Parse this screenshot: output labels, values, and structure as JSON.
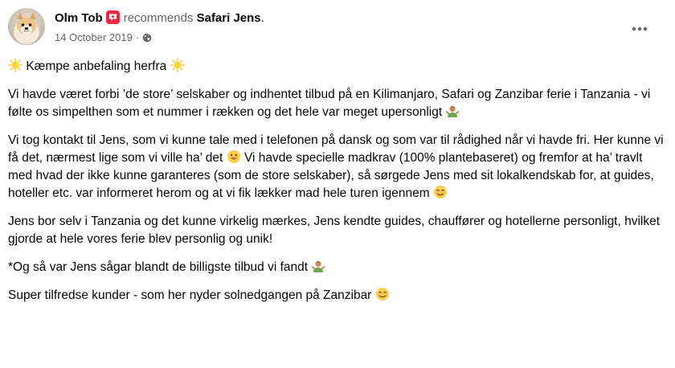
{
  "post": {
    "author_name": "Olm Tob",
    "action_text": "recommends",
    "page_name": "Safari Jens",
    "trailing_dot": ".",
    "date": "14 October 2019",
    "date_separator": "·",
    "more_icon": "more-horizontal-icon",
    "privacy_icon": "globe-icon",
    "badge_icon": "recommend-badge-icon",
    "colors": {
      "badge": "#f02849",
      "secondary_text": "#65676b",
      "primary_text": "#050505"
    }
  },
  "content": {
    "p1": "Kæmpe anbefaling herfra",
    "p2": "Vi havde været forbi ’de store’ selskaber og indhentet tilbud på en Kilimanjaro, Safari og Zanzibar ferie i Tanzania - vi følte os simpelthen som et nummer i rækken og det hele var meget upersonligt",
    "p3a": "Vi tog kontakt til Jens, som vi kunne tale med i telefonen på dansk og som var til rådighed når vi havde fri. Her kunne vi få det, nærmest lige som vi ville ha’ det",
    "p3b": "Vi havde specielle madkrav (100% plantebaseret) og fremfor at ha’ travlt med hvad der ikke kunne garanteres (som de store selskaber), så sørgede Jens med sit lokalkendskab for, at guides, hoteller etc. var informeret herom og at vi fik lækker mad hele turen igennem",
    "p4": "Jens bor selv i Tanzania og det kunne virkelig mærkes, Jens kendte guides, chauffører og hotellerne personligt, hvilket gjorde at hele vores ferie blev personlig og unik!",
    "p5": "*Og så var Jens sågar blandt de billigste tilbud vi fandt",
    "p6": "Super tilfredse kunder - som her nyder solnedgangen på Zanzibar",
    "emojis": [
      "sun-emoji",
      "person-shrugging-emoji",
      "grinning-face-emoji",
      "smiling-face-emoji"
    ]
  }
}
